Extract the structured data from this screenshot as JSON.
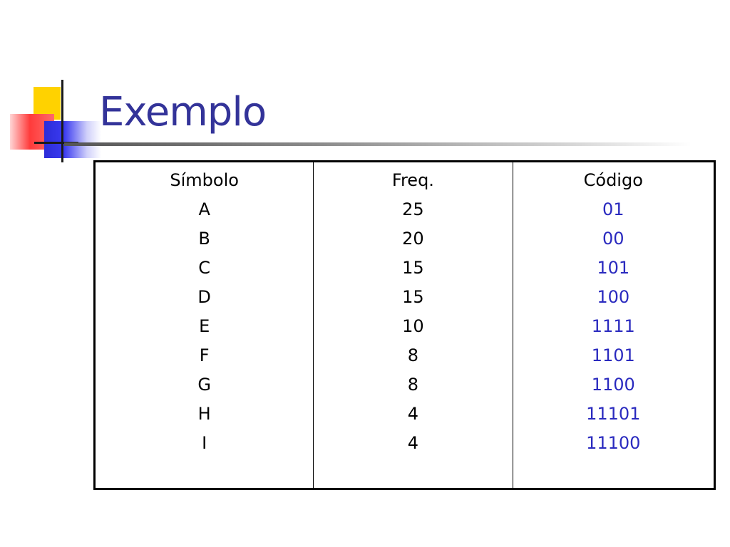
{
  "title": "Exemplo",
  "colors": {
    "title": "#333399",
    "code_text": "#2a2abf",
    "deco_yellow": "#ffd200",
    "deco_red": "#ff3b3b",
    "deco_blue": "#2c2cd8"
  },
  "table": {
    "headers": [
      "Símbolo",
      "Freq.",
      "Código"
    ],
    "rows": [
      {
        "symbol": "A",
        "freq": "25",
        "code": "01"
      },
      {
        "symbol": "B",
        "freq": "20",
        "code": "00"
      },
      {
        "symbol": "C",
        "freq": "15",
        "code": "101"
      },
      {
        "symbol": "D",
        "freq": "15",
        "code": "100"
      },
      {
        "symbol": "E",
        "freq": "10",
        "code": "1111"
      },
      {
        "symbol": "F",
        "freq": "8",
        "code": "1101"
      },
      {
        "symbol": "G",
        "freq": "8",
        "code": "1100"
      },
      {
        "symbol": "H",
        "freq": "4",
        "code": "11101"
      },
      {
        "symbol": "I",
        "freq": "4",
        "code": "11100"
      }
    ]
  }
}
